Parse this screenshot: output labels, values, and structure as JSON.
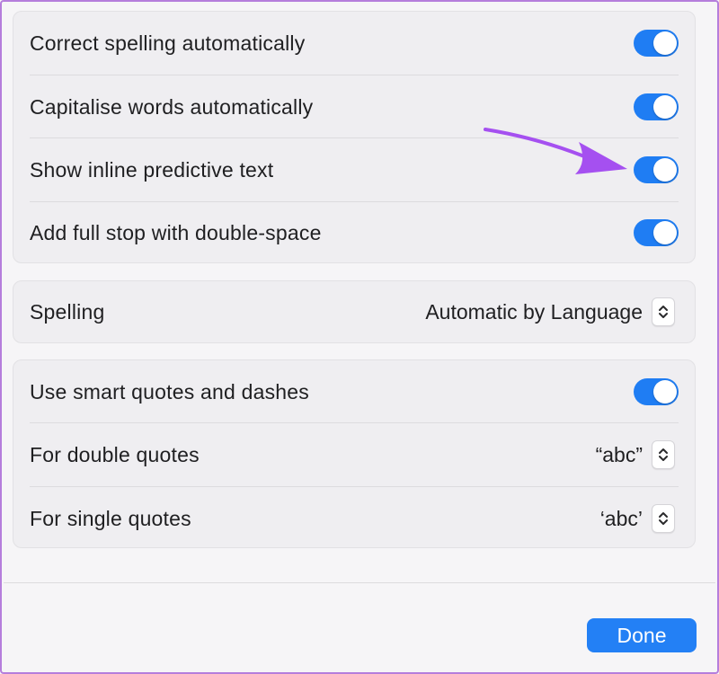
{
  "typing_settings": {
    "rows": [
      {
        "label": "Correct spelling automatically",
        "on": true
      },
      {
        "label": "Capitalise words automatically",
        "on": true
      },
      {
        "label": "Show inline predictive text",
        "on": true
      },
      {
        "label": "Add full stop with double-space",
        "on": true
      }
    ]
  },
  "spelling": {
    "label": "Spelling",
    "value": "Automatic by Language"
  },
  "quotes": {
    "smart_label": "Use smart quotes and dashes",
    "smart_on": true,
    "double_label": "For double quotes",
    "double_value": "“abc”",
    "single_label": "For single quotes",
    "single_value": "‘abc’"
  },
  "footer": {
    "done_label": "Done"
  },
  "colors": {
    "accent": "#1f7df3",
    "highlight_arrow": "#a550f0"
  },
  "icons": {
    "stepper": "up-down-chevron-icon",
    "annotation": "pointer-arrow-icon"
  }
}
